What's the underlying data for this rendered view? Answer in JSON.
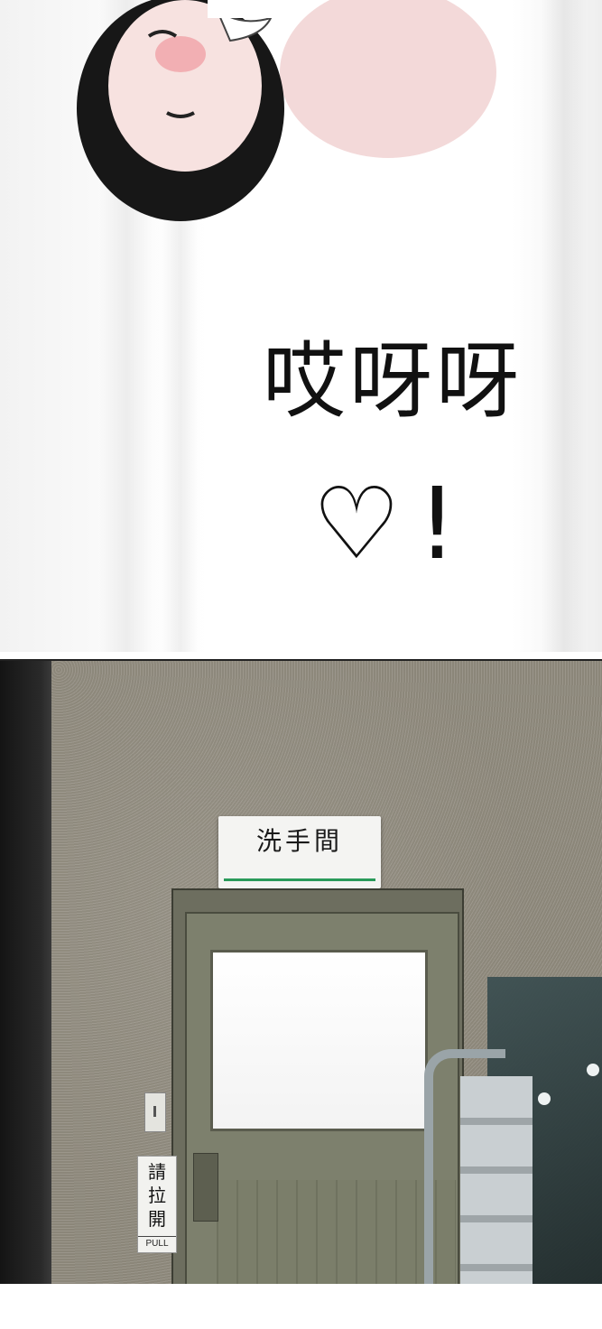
{
  "panel_top": {
    "speech_line_1": "哎呀呀",
    "speech_line_2": "♡!"
  },
  "panel_bottom": {
    "restroom_sign": "洗手間",
    "pull_sign_cjk": "請\n拉\n開",
    "pull_sign_en": "PULL"
  },
  "colors": {
    "wall": "#8e897d",
    "door": "#7d806d",
    "sign_stripe": "#2a9a5a"
  }
}
